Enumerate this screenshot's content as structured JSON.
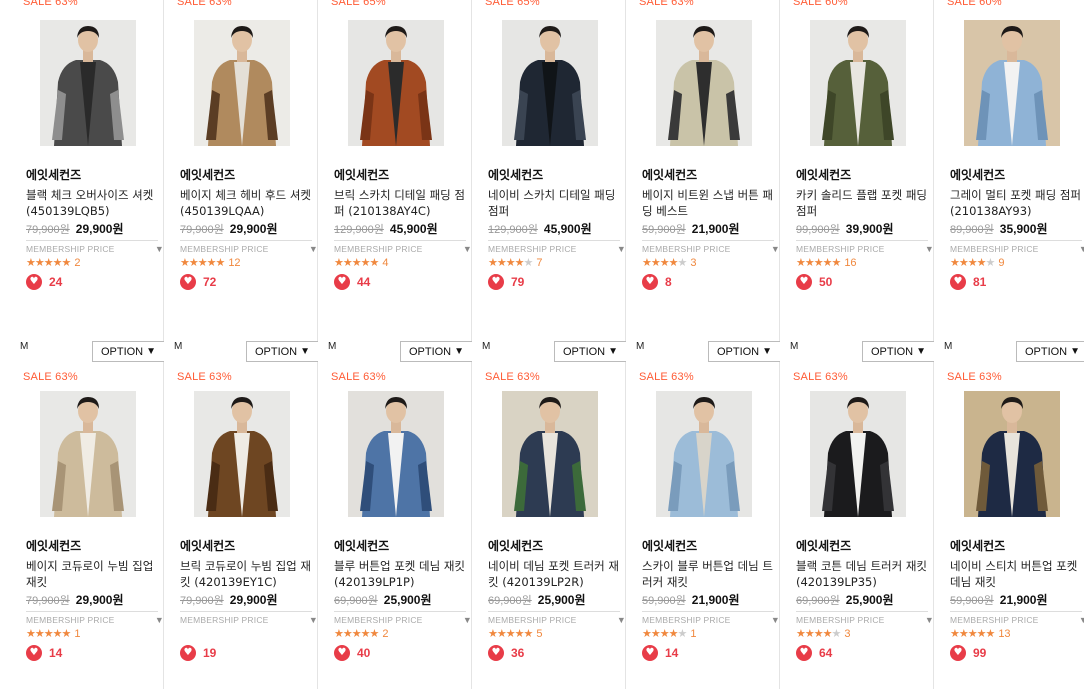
{
  "rows": [
    {
      "size_label": "M",
      "option_label": "OPTION",
      "items": [
        {
          "sale": "SALE 63%",
          "brand": "에잇세컨즈",
          "name": "블랙 체크 오버사이즈 셔켓 (450139LQB5)",
          "orig": "79,900원",
          "price": "29,900원",
          "member": "MEMBERSHIP PRICE",
          "stars": "★★★★★",
          "empty": "",
          "reviews": "2",
          "likes": "24",
          "colors": {
            "bg": "#e8e8e6",
            "coat": "#4a4a4a",
            "accent": "#8e8e8e",
            "inner": "#2a2a2a"
          }
        },
        {
          "sale": "SALE 63%",
          "brand": "에잇세컨즈",
          "name": "베이지 체크 헤비 후드 셔켓 (450139LQAA)",
          "orig": "79,900원",
          "price": "29,900원",
          "member": "MEMBERSHIP PRICE",
          "stars": "★★★★★",
          "empty": "",
          "reviews": "12",
          "likes": "72",
          "colors": {
            "bg": "#ecebe7",
            "coat": "#b08a5e",
            "accent": "#5b3d24",
            "inner": "#e4dfd6"
          }
        },
        {
          "sale": "SALE 65%",
          "brand": "에잇세컨즈",
          "name": "브릭 스카치 디테일 패딩 점퍼 (210138AY4C)",
          "orig": "129,900원",
          "price": "45,900원",
          "member": "MEMBERSHIP PRICE",
          "stars": "★★★★★",
          "empty": "",
          "reviews": "4",
          "likes": "44",
          "colors": {
            "bg": "#e6e6e4",
            "coat": "#a24a22",
            "accent": "#7a3416",
            "inner": "#2b2b2b"
          }
        },
        {
          "sale": "SALE 65%",
          "brand": "에잇세컨즈",
          "name": "네이비 스카치 디테일 패딩 점퍼",
          "orig": "129,900원",
          "price": "45,900원",
          "member": "MEMBERSHIP PRICE",
          "stars": "★★★★",
          "empty": "★",
          "reviews": "7",
          "likes": "79",
          "colors": {
            "bg": "#e6e6e4",
            "coat": "#1f2733",
            "accent": "#3a4452",
            "inner": "#101418"
          }
        },
        {
          "sale": "SALE 63%",
          "brand": "에잇세컨즈",
          "name": "베이지 비트윈 스냅 버튼 패딩 베스트",
          "orig": "59,900원",
          "price": "21,900원",
          "member": "MEMBERSHIP PRICE",
          "stars": "★★★★",
          "empty": "★",
          "reviews": "3",
          "likes": "8",
          "colors": {
            "bg": "#e8e8e6",
            "coat": "#c9c3a8",
            "accent": "#3a3a3a",
            "inner": "#2e2e2e"
          }
        },
        {
          "sale": "SALE 60%",
          "brand": "에잇세컨즈",
          "name": "카키 솔리드 플랩 포켓 패딩 점퍼",
          "orig": "99,900원",
          "price": "39,900원",
          "member": "MEMBERSHIP PRICE",
          "stars": "★★★★★",
          "empty": "",
          "reviews": "16",
          "likes": "50",
          "colors": {
            "bg": "#e8e8e6",
            "coat": "#56603a",
            "accent": "#3e4628",
            "inner": "#e8e6e0"
          }
        },
        {
          "sale": "SALE 60%",
          "brand": "에잇세컨즈",
          "name": "그레이 멀티 포켓 패딩 점퍼 (210138AY93)",
          "orig": "89,900원",
          "price": "35,900원",
          "member": "MEMBERSHIP PRICE",
          "stars": "★★★★",
          "empty": "★",
          "reviews": "9",
          "likes": "81",
          "colors": {
            "bg": "#d8c5a8",
            "coat": "#8fb3d6",
            "accent": "#6e93b8",
            "inner": "#f2f2f2"
          }
        }
      ]
    },
    {
      "items": [
        {
          "sale": "SALE 63%",
          "brand": "에잇세컨즈",
          "name": "베이지 코듀로이 누빔 집업 재킷",
          "orig": "79,900원",
          "price": "29,900원",
          "member": "MEMBERSHIP PRICE",
          "stars": "★★★★★",
          "empty": "",
          "reviews": "1",
          "likes": "14",
          "colors": {
            "bg": "#e8e8e6",
            "coat": "#cdbb9c",
            "accent": "#a89476",
            "inner": "#f0ece4"
          }
        },
        {
          "sale": "SALE 63%",
          "brand": "에잇세컨즈",
          "name": "브릭 코듀로이 누빔 집업 재킷 (420139EY1C)",
          "orig": "79,900원",
          "price": "29,900원",
          "member": "MEMBERSHIP PRICE",
          "stars": "",
          "empty": "",
          "reviews": "",
          "likes": "19",
          "colors": {
            "bg": "#e8e8e6",
            "coat": "#6e4622",
            "accent": "#4a2c14",
            "inner": "#efebe4"
          }
        },
        {
          "sale": "SALE 63%",
          "brand": "에잇세컨즈",
          "name": "블루 버튼업 포켓 데님 재킷 (420139LP1P)",
          "orig": "69,900원",
          "price": "25,900원",
          "member": "MEMBERSHIP PRICE",
          "stars": "★★★★★",
          "empty": "",
          "reviews": "2",
          "likes": "40",
          "colors": {
            "bg": "#e2e0dc",
            "coat": "#4e74a6",
            "accent": "#2f4e7a",
            "inner": "#f2f2f2"
          }
        },
        {
          "sale": "SALE 63%",
          "brand": "에잇세컨즈",
          "name": "네이비 데님 포켓 트러커 재킷 (420139LP2R)",
          "orig": "69,900원",
          "price": "25,900원",
          "member": "MEMBERSHIP PRICE",
          "stars": "★★★★★",
          "empty": "",
          "reviews": "5",
          "likes": "36",
          "colors": {
            "bg": "#d9d3c4",
            "coat": "#2d3b52",
            "accent": "#3c6a3a",
            "inner": "#e8e4dc"
          }
        },
        {
          "sale": "SALE 63%",
          "brand": "에잇세컨즈",
          "name": "스카이 블루 버튼업 데님 트러커 재킷",
          "orig": "59,900원",
          "price": "21,900원",
          "member": "MEMBERSHIP PRICE",
          "stars": "★★★★",
          "empty": "★",
          "reviews": "1",
          "likes": "14",
          "colors": {
            "bg": "#e6e6e4",
            "coat": "#9cbcd8",
            "accent": "#7a9cbc",
            "inner": "#d8d4ca"
          }
        },
        {
          "sale": "SALE 63%",
          "brand": "에잇세컨즈",
          "name": "블랙 코튼 데님 트러커 재킷 (420139LP35)",
          "orig": "69,900원",
          "price": "25,900원",
          "member": "MEMBERSHIP PRICE",
          "stars": "★★★★",
          "empty": "★",
          "reviews": "3",
          "likes": "64",
          "colors": {
            "bg": "#e6e6e4",
            "coat": "#1b1b1d",
            "accent": "#333336",
            "inner": "#f2f2f0"
          }
        },
        {
          "sale": "SALE 63%",
          "brand": "에잇세컨즈",
          "name": "네이비 스티치 버튼업 포켓 데님 재킷",
          "orig": "59,900원",
          "price": "21,900원",
          "member": "MEMBERSHIP PRICE",
          "stars": "★★★★★",
          "empty": "",
          "reviews": "13",
          "likes": "99",
          "colors": {
            "bg": "#c9b48e",
            "coat": "#1e2a44",
            "accent": "#6f5a3a",
            "inner": "#e8e4dc"
          }
        }
      ]
    }
  ]
}
